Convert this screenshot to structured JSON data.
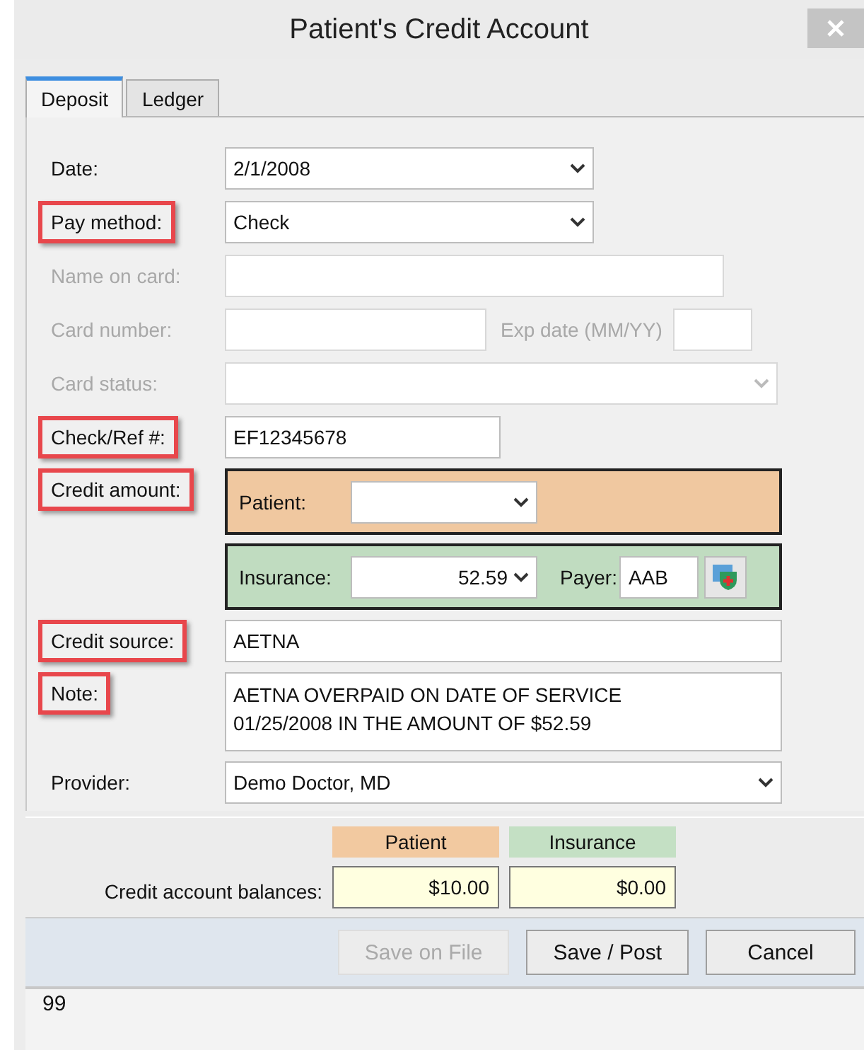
{
  "window": {
    "title": "Patient's Credit Account"
  },
  "tabs": [
    {
      "label": "Deposit",
      "selected": true
    },
    {
      "label": "Ledger",
      "selected": false
    }
  ],
  "date": {
    "label": "Date:",
    "highlighted": false,
    "disabled": false,
    "value": "2/1/2008"
  },
  "pay_method": {
    "label": "Pay method:",
    "highlighted": true,
    "disabled": false,
    "value": "Check"
  },
  "name_on_card": {
    "label": "Name on card:",
    "highlighted": false,
    "disabled": true
  },
  "card_number": {
    "label": "Card number:",
    "highlighted": false,
    "disabled": true
  },
  "exp_date": {
    "label": "Exp date (MM/YY)",
    "disabled": true
  },
  "card_status": {
    "label": "Card status:",
    "highlighted": false,
    "disabled": true
  },
  "check_ref": {
    "label": "Check/Ref #:",
    "highlighted": true,
    "disabled": false,
    "value": "EF12345678"
  },
  "credit_amount": {
    "label": "Credit amount:",
    "highlighted": true,
    "disabled": false,
    "patient_label": "Patient:",
    "insurance_label": "Insurance:",
    "insurance_value": "52.59",
    "payer_label": "Payer:",
    "payer_value": "AAB"
  },
  "credit_source": {
    "label": "Credit source:",
    "highlighted": true,
    "disabled": false,
    "value": "AETNA"
  },
  "note": {
    "label": "Note:",
    "highlighted": true,
    "disabled": false,
    "value": "AETNA OVERPAID ON DATE OF SERVICE\n01/25/2008 IN THE AMOUNT OF $52.59"
  },
  "provider": {
    "label": "Provider:",
    "highlighted": false,
    "disabled": false,
    "value": "Demo Doctor, MD"
  },
  "balances": {
    "label": "Credit account balances:",
    "columns": [
      {
        "heading": "Patient",
        "value": "$10.00",
        "color": "#f2c9a0"
      },
      {
        "heading": "Insurance",
        "value": "$0.00",
        "color": "#c4e0c4"
      }
    ]
  },
  "buttons": [
    {
      "label": "Save on File",
      "disabled": true
    },
    {
      "label": "Save / Post",
      "disabled": false
    },
    {
      "label": "Cancel",
      "disabled": false
    }
  ],
  "status_bar": {
    "text": "99"
  }
}
